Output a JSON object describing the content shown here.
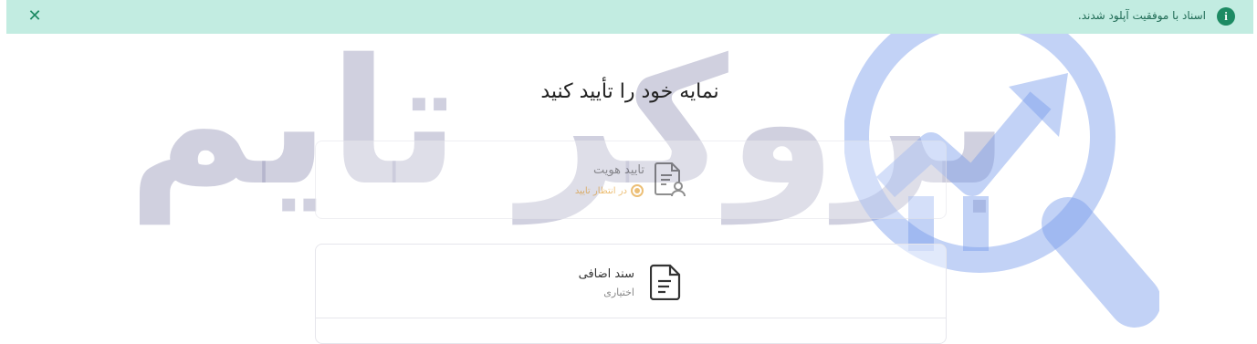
{
  "toast": {
    "message": "اسناد با موفقیت آپلود شدند.",
    "info_icon": "info-icon",
    "close_icon": "close-icon",
    "color": "#c2ece1",
    "accent": "#1d8a63"
  },
  "watermark": {
    "text": "بروکر تایم",
    "logo_icon": "magnifier-logo-icon"
  },
  "main": {
    "title": "نمایه خود را تأیید کنید"
  },
  "cards": [
    {
      "title": "تایید هویت",
      "status": "در انتظار تایید",
      "status_color": "#e0961d",
      "icon": "document-user-icon"
    },
    {
      "title": "سند اضافی",
      "subtitle": "اختیاری",
      "icon": "document-icon"
    }
  ]
}
